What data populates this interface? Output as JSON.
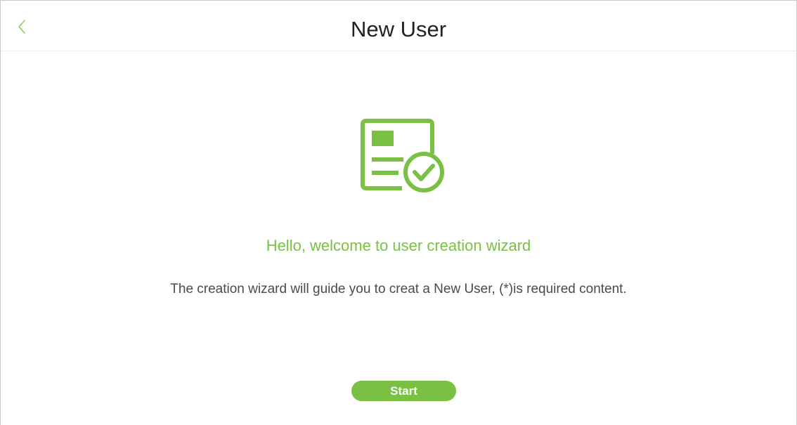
{
  "header": {
    "title": "New User",
    "back_icon": "chevron-left-icon"
  },
  "hero": {
    "icon": "user-card-check-icon"
  },
  "main": {
    "welcome": "Hello, welcome to user creation wizard",
    "description": "The creation wizard will guide you to creat a New User, (*)is required content."
  },
  "actions": {
    "start_label": "Start"
  },
  "colors": {
    "accent": "#7ac143",
    "title_text": "#222222",
    "body_text": "#4a4a4a",
    "background": "#ffffff"
  }
}
